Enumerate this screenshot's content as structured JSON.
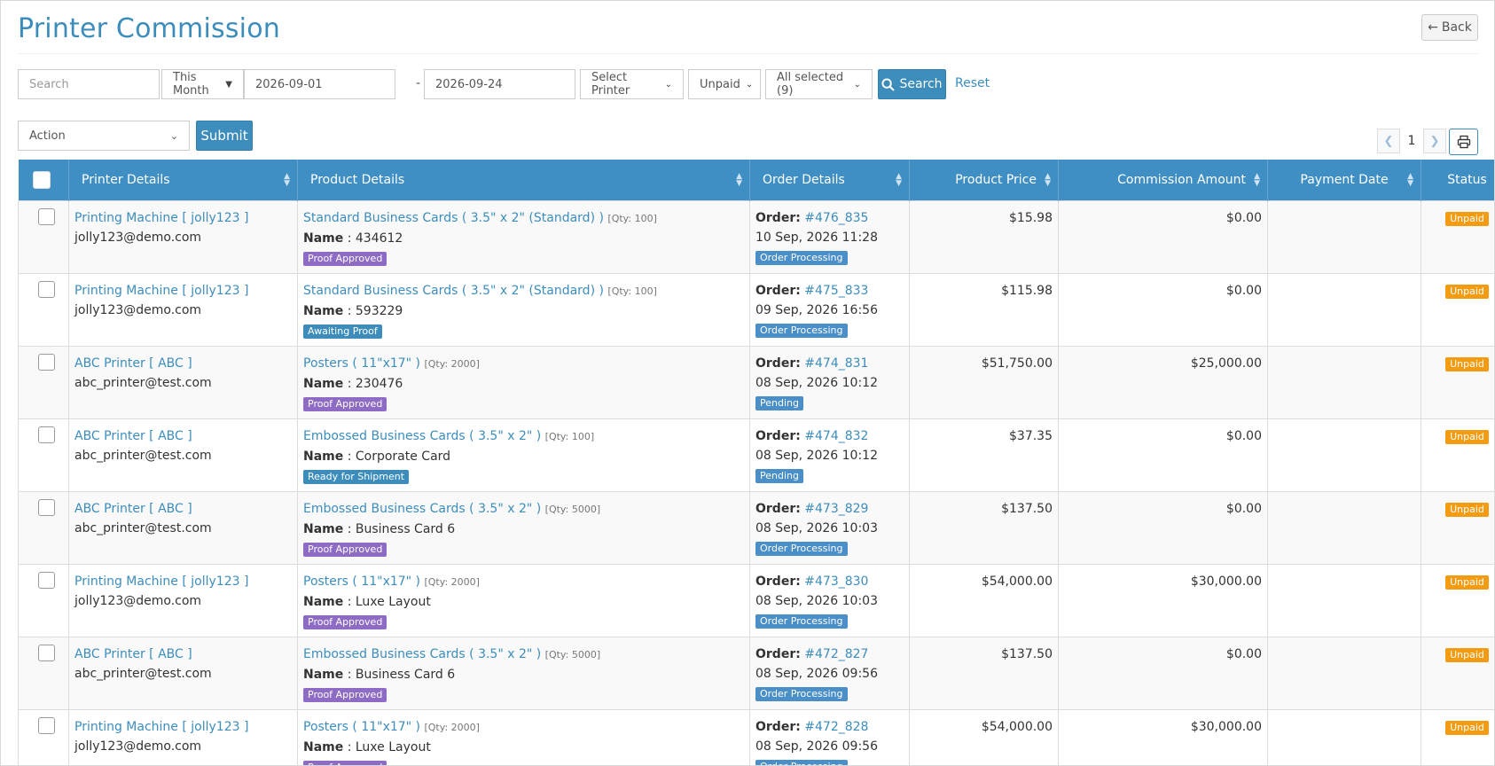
{
  "header": {
    "title": "Printer Commission",
    "back_label": "Back"
  },
  "filters": {
    "search_placeholder": "Search",
    "period": "This Month",
    "date_from": "2026-09-01",
    "date_to": "2026-09-24",
    "printer": "Select Printer",
    "payment_status": "Unpaid",
    "statuses": "All selected (9)",
    "search_label": "Search",
    "reset_label": "Reset"
  },
  "bulk": {
    "action_label": "Action",
    "submit_label": "Submit"
  },
  "pagination": {
    "page": "1"
  },
  "table": {
    "columns": [
      "Printer Details",
      "Product Details",
      "Order Details",
      "Product Price",
      "Commission Amount",
      "Payment Date",
      "Status"
    ],
    "name_label": "Name",
    "order_label": "Order:",
    "rows": [
      {
        "printer": "Printing Machine [ jolly123 ]",
        "email": "jolly123@demo.com",
        "product": "Standard Business Cards ( 3.5\" x 2\" (Standard) )",
        "qty": "[Qty: 100]",
        "name": "434612",
        "proof": "Proof Approved",
        "order": "#476_835",
        "date": "10 Sep, 2026 11:28",
        "order_status": "Order Processing",
        "price": "$15.98",
        "commission": "$0.00",
        "payment_date": "",
        "status": "Unpaid"
      },
      {
        "printer": "Printing Machine [ jolly123 ]",
        "email": "jolly123@demo.com",
        "product": "Standard Business Cards ( 3.5\" x 2\" (Standard) )",
        "qty": "[Qty: 100]",
        "name": "593229",
        "proof": "Awaiting Proof",
        "order": "#475_833",
        "date": "09 Sep, 2026 16:56",
        "order_status": "Order Processing",
        "price": "$115.98",
        "commission": "$0.00",
        "payment_date": "",
        "status": "Unpaid"
      },
      {
        "printer": "ABC Printer [ ABC ]",
        "email": "abc_printer@test.com",
        "product": "Posters ( 11\"x17\" )",
        "qty": "[Qty: 2000]",
        "name": "230476",
        "proof": "Proof Approved",
        "order": "#474_831",
        "date": "08 Sep, 2026 10:12",
        "order_status": "Pending",
        "price": "$51,750.00",
        "commission": "$25,000.00",
        "payment_date": "",
        "status": "Unpaid"
      },
      {
        "printer": "ABC Printer [ ABC ]",
        "email": "abc_printer@test.com",
        "product": "Embossed Business Cards ( 3.5\" x 2\" )",
        "qty": "[Qty: 100]",
        "name": "Corporate Card",
        "proof": "Ready for Shipment",
        "order": "#474_832",
        "date": "08 Sep, 2026 10:12",
        "order_status": "Pending",
        "price": "$37.35",
        "commission": "$0.00",
        "payment_date": "",
        "status": "Unpaid"
      },
      {
        "printer": "ABC Printer [ ABC ]",
        "email": "abc_printer@test.com",
        "product": "Embossed Business Cards ( 3.5\" x 2\" )",
        "qty": "[Qty: 5000]",
        "name": "Business Card 6",
        "proof": "Proof Approved",
        "order": "#473_829",
        "date": "08 Sep, 2026 10:03",
        "order_status": "Order Processing",
        "price": "$137.50",
        "commission": "$0.00",
        "payment_date": "",
        "status": "Unpaid"
      },
      {
        "printer": "Printing Machine [ jolly123 ]",
        "email": "jolly123@demo.com",
        "product": "Posters ( 11\"x17\" )",
        "qty": "[Qty: 2000]",
        "name": "Luxe Layout",
        "proof": "Proof Approved",
        "order": "#473_830",
        "date": "08 Sep, 2026 10:03",
        "order_status": "Order Processing",
        "price": "$54,000.00",
        "commission": "$30,000.00",
        "payment_date": "",
        "status": "Unpaid"
      },
      {
        "printer": "ABC Printer [ ABC ]",
        "email": "abc_printer@test.com",
        "product": "Embossed Business Cards ( 3.5\" x 2\" )",
        "qty": "[Qty: 5000]",
        "name": "Business Card 6",
        "proof": "Proof Approved",
        "order": "#472_827",
        "date": "08 Sep, 2026 09:56",
        "order_status": "Order Processing",
        "price": "$137.50",
        "commission": "$0.00",
        "payment_date": "",
        "status": "Unpaid"
      },
      {
        "printer": "Printing Machine [ jolly123 ]",
        "email": "jolly123@demo.com",
        "product": "Posters ( 11\"x17\" )",
        "qty": "[Qty: 2000]",
        "name": "Luxe Layout",
        "proof": "Proof Approved",
        "order": "#472_828",
        "date": "08 Sep, 2026 09:56",
        "order_status": "Order Processing",
        "price": "$54,000.00",
        "commission": "$30,000.00",
        "payment_date": "",
        "status": "Unpaid"
      }
    ]
  },
  "colors": {
    "accent": "#3c8dbc",
    "proof": "#8e6bc4",
    "unpaid": "#f39c12"
  },
  "icons": {
    "back": "arrow-left-icon",
    "search": "magnifier-icon",
    "print": "printer-icon"
  }
}
